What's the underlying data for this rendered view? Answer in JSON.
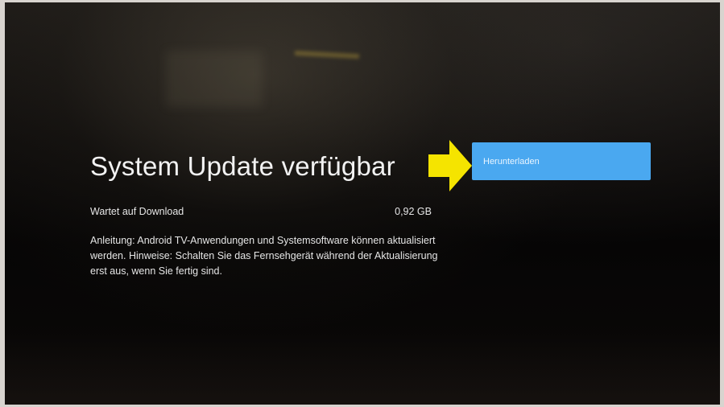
{
  "dialog": {
    "title": "System Update verfügbar",
    "status_label": "Wartet auf Download",
    "file_size": "0,92 GB",
    "description": "Anleitung: Android TV-Anwendungen und Systemsoftware können aktualisiert werden. Hinweise: Schalten Sie das Fernsehgerät während der Aktualisierung erst aus, wenn Sie fertig sind."
  },
  "actions": {
    "download_label": "Herunterladen"
  },
  "colors": {
    "button": "#4aa8f0",
    "arrow": "#f5e400"
  }
}
